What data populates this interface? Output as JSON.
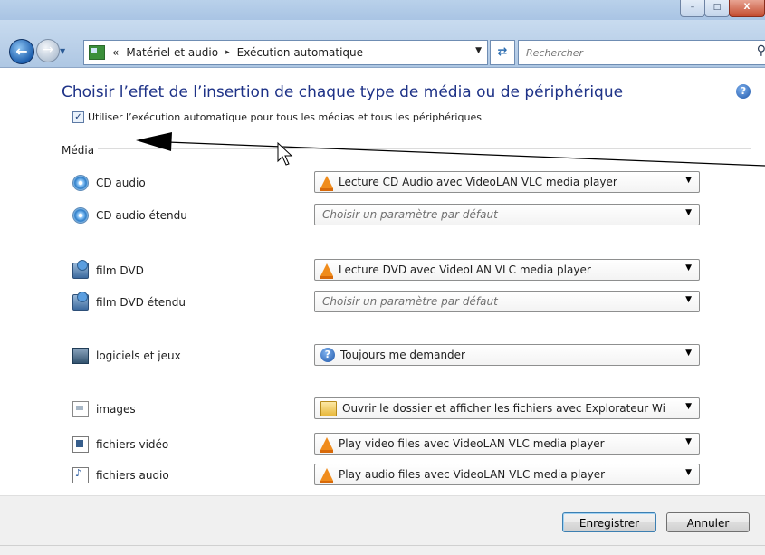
{
  "window": {
    "minimize_glyph": "–",
    "maximize_glyph": "□",
    "close_glyph": "X"
  },
  "nav": {
    "back_icon": "back-arrow-icon",
    "forward_icon": "forward-arrow-icon",
    "breadcrumb_prefix": "«",
    "breadcrumb": [
      "Matériel et audio",
      "Exécution automatique"
    ],
    "breadcrumb_separator": "▸",
    "search_placeholder": "Rechercher"
  },
  "page": {
    "heading": "Choisir l’effet de l’insertion de chaque type de média ou de périphérique",
    "autoplay_checkbox_label": "Utiliser l’exécution automatique pour tous les médias et tous les périphériques",
    "autoplay_checked": true,
    "section_label": "Média"
  },
  "media_rows": [
    {
      "label": "CD audio",
      "icon": "cd-icon",
      "value": "Lecture CD Audio avec VideoLAN VLC media player",
      "option_icon": "vlc-icon",
      "placeholder": false
    },
    {
      "label": "CD audio étendu",
      "icon": "cd-icon",
      "value": "Choisir un paramètre par défaut",
      "option_icon": "",
      "placeholder": true
    },
    {
      "label": "film DVD",
      "icon": "dvd-icon",
      "value": "Lecture DVD avec VideoLAN VLC media player",
      "option_icon": "vlc-icon",
      "placeholder": false
    },
    {
      "label": "film DVD étendu",
      "icon": "dvd-icon",
      "value": "Choisir un paramètre par défaut",
      "option_icon": "",
      "placeholder": true
    },
    {
      "label": "logiciels et jeux",
      "icon": "game-icon",
      "value": "Toujours me demander",
      "option_icon": "question-icon",
      "placeholder": false
    },
    {
      "label": "images",
      "icon": "image-file-icon",
      "value": "Ouvrir le dossier et afficher les fichiers avec Explorateur Wi",
      "option_icon": "folder-icon",
      "placeholder": false
    },
    {
      "label": "fichiers vidéo",
      "icon": "video-file-icon",
      "value": "Play video files avec VideoLAN VLC media player",
      "option_icon": "vlc-icon",
      "placeholder": false
    },
    {
      "label": "fichiers audio",
      "icon": "audio-file-icon",
      "value": "Play audio files avec VideoLAN VLC media player",
      "option_icon": "vlc-icon",
      "placeholder": false
    }
  ],
  "footer": {
    "save_label": "Enregistrer",
    "cancel_label": "Annuler"
  },
  "colors": {
    "heading": "#1e3287",
    "annotation_arrow": "#000000"
  }
}
